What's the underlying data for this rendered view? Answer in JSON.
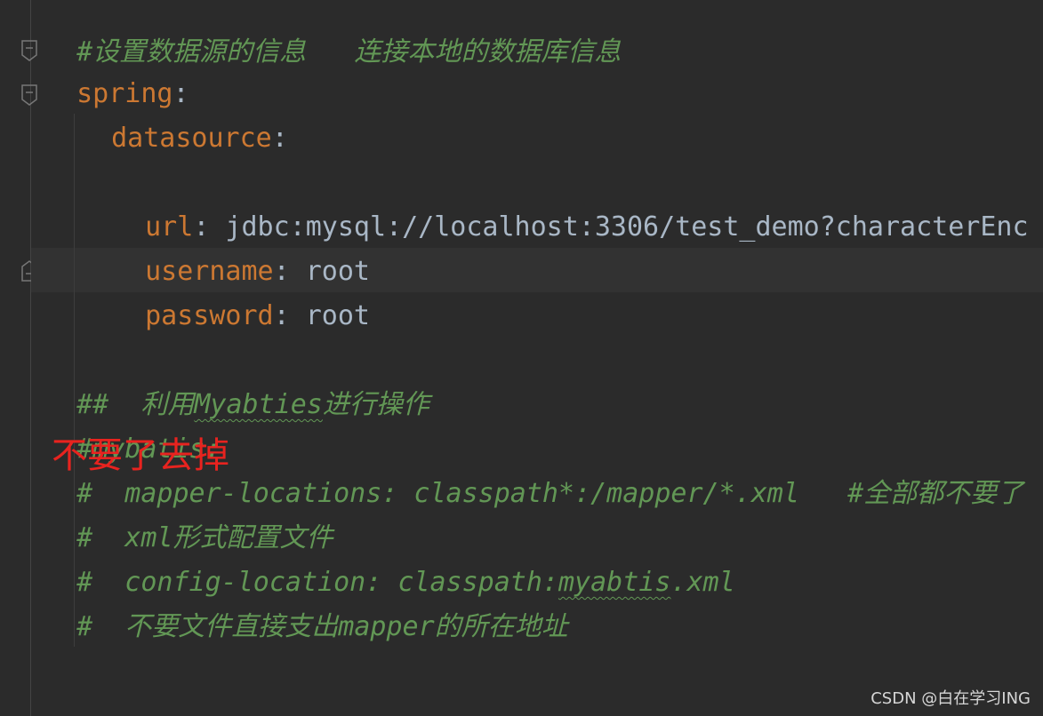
{
  "editor": {
    "lines": [
      {
        "id": "l0",
        "kind": "comment",
        "text": "#设置数据源的信息   连接本地的数据库信息"
      },
      {
        "id": "l1",
        "key": "spring",
        "colon": ":"
      },
      {
        "id": "l2",
        "key": "datasource",
        "colon": ":"
      },
      {
        "id": "l3",
        "key": "url",
        "colon": ":",
        "value": " jdbc:mysql://localhost:3306/test_demo?characterEnc"
      },
      {
        "id": "l4",
        "key": "username",
        "colon": ":",
        "value": " root"
      },
      {
        "id": "l5",
        "key": "password",
        "colon": ":",
        "value": " root"
      },
      {
        "id": "l6",
        "kind": "comment",
        "prefix": "##  利用",
        "squiggle": "Myabties",
        "suffix": "进行操作"
      },
      {
        "id": "l7",
        "kind": "comment",
        "text": "#mybatis:"
      },
      {
        "id": "l8",
        "kind": "comment",
        "text": "#  mapper-locations: classpath*:/mapper/*.xml   #全部都不要了"
      },
      {
        "id": "l9",
        "kind": "comment",
        "text": "#  xml形式配置文件"
      },
      {
        "id": "l10",
        "kind": "comment",
        "prefix": "#  config-location: classpath:",
        "squiggle": "myabtis",
        "suffix": ".xml"
      },
      {
        "id": "l11",
        "kind": "comment",
        "text": "#  不要文件直接支出mapper的所在地址"
      }
    ]
  },
  "annotation": {
    "text": "不要了去掉",
    "color": "#e8231f"
  },
  "watermark": {
    "text": "CSDN @白在学习ING"
  },
  "colors": {
    "background": "#2b2b2b",
    "key": "#cc7832",
    "comment": "#629755",
    "text": "#a9b7c6",
    "caret_line": "#323232"
  }
}
